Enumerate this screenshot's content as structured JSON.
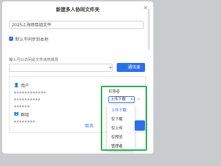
{
  "dialog": {
    "title": "新建多人协同文件夹",
    "close_icon": "close-icon"
  },
  "folder": {
    "name_value": "2025上海项目组文件",
    "checkbox_label": "默认不同步到本地",
    "checkbox_checked": true
  },
  "members": {
    "label": "输入可以访问此文件夹的成员",
    "input_value": "",
    "add_symbol": "+",
    "contacts_button": "通讯录"
  },
  "list": {
    "user_label": "用户",
    "group_label": "群组",
    "blurred_1": "▪▪▪▪▪▪▪▪▪▪▪▪",
    "blurred_2": "▪▪▪▪▪▪▪▪▪▪",
    "blurred_3": "▪▪▪▪▪▪",
    "blurred_4": "▪▪▪▪▪▪▪▪"
  },
  "permission": {
    "header": "权限者",
    "selected": "上传下载",
    "remove_symbol": "⊖",
    "options": [
      "上传下载",
      "仅下载",
      "仅上传",
      "仅预览",
      "管理者"
    ]
  },
  "footer": {
    "cancel_label": "取消"
  },
  "colors": {
    "accent": "#2f6fe6",
    "highlight": "#22b24c"
  }
}
